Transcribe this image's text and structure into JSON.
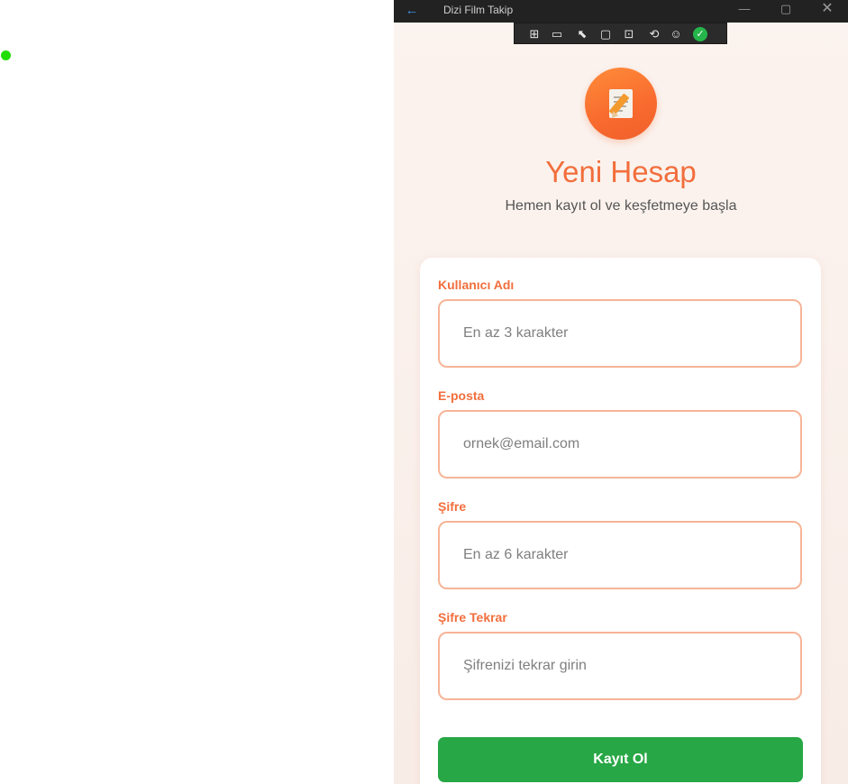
{
  "window": {
    "title": "Dizi Film Takip",
    "back_icon": "←",
    "minimize_icon": "—",
    "maximize_icon": "▢",
    "close_icon": "✕"
  },
  "devtools": {
    "icons": [
      "live-visual-tree-icon",
      "video-icon",
      "select-element-icon",
      "display-layout-adorners-icon",
      "track-focus-icon",
      "hot-reload-icon",
      "accessibility-icon",
      "ok-check-icon"
    ],
    "glyphs": [
      "⊞",
      "▭",
      "⬉",
      "▢",
      "⊡",
      "⟲",
      "☺",
      "✓"
    ]
  },
  "header": {
    "title": "Yeni Hesap",
    "subtitle": "Hemen kayıt ol ve keşfetmeye başla"
  },
  "form": {
    "username": {
      "label": "Kullanıcı Adı",
      "placeholder": "En az 3 karakter",
      "value": ""
    },
    "email": {
      "label": "E-posta",
      "placeholder": "ornek@email.com",
      "value": ""
    },
    "password": {
      "label": "Şifre",
      "placeholder": "En az 6 karakter",
      "value": ""
    },
    "password_confirm": {
      "label": "Şifre Tekrar",
      "placeholder": "Şifrenizi tekrar girin",
      "value": ""
    },
    "submit_label": "Kayıt Ol"
  },
  "colors": {
    "accent": "#f26e3c",
    "input_border": "#f6b497",
    "submit": "#27a745",
    "indicator": "#22dd00"
  }
}
